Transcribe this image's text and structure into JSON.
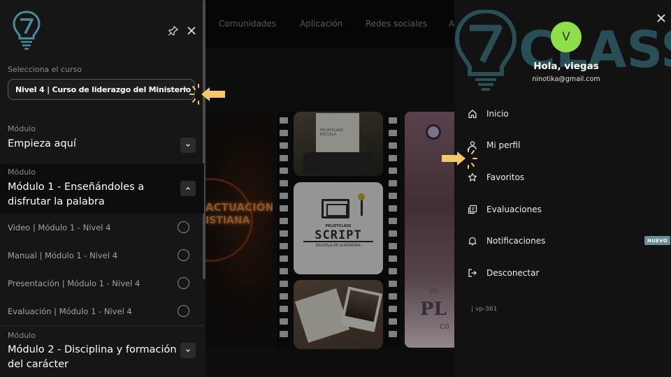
{
  "topnav": {
    "items": [
      "Comunidades",
      "Aplicación",
      "Redes sociales",
      "A"
    ]
  },
  "background": {
    "left_card_text": [
      "ACTUACIÓN",
      "ISTIANA"
    ],
    "script_card": {
      "small_top": "PELIZYCLASS",
      "title": "SCRIPT",
      "subtitle": "ESCUELA DE GUIONISTAS",
      "paper_text": "PELIZYCLASS ESCUELA"
    },
    "right_card_text": {
      "big": "PL",
      "small": "co",
      "script": "m"
    }
  },
  "left_drawer": {
    "course_label": "Selecciona el curso",
    "course_value": "Nivel 4 | Curso de liderazgo del Ministerio",
    "modules": [
      {
        "tag": "Módulo",
        "title": "Empieza aquí",
        "expanded": false
      },
      {
        "tag": "Módulo",
        "title": "Módulo 1 - Enseñándoles a disfrutar la palabra",
        "expanded": true,
        "lessons": [
          "Video | Módulo 1 - Nivel 4",
          "Manual | Módulo 1 - Nivel 4",
          "Presentación | Módulo 1 - Nivel 4",
          "Evaluación | Módulo 1 - Nivel 4"
        ]
      },
      {
        "tag": "Módulo",
        "title": "Módulo 2 - Disciplina y formación del carácter",
        "expanded": false
      }
    ]
  },
  "right_drawer": {
    "logo_text": "CLASS",
    "avatar_letter": "V",
    "greeting": "Hola, viegas",
    "email": "ninotika@gmail.com",
    "menu": [
      {
        "icon": "home-icon",
        "label": "Inicio"
      },
      {
        "icon": "user-icon",
        "label": "Mi perfil"
      },
      {
        "icon": "star-icon",
        "label": "Favoritos"
      },
      {
        "icon": "evaluations-icon",
        "label": "Evaluaciones"
      },
      {
        "icon": "bell-icon",
        "label": "Notificaciones"
      },
      {
        "icon": "logout-icon",
        "label": "Desconectar"
      }
    ],
    "notifications_badge": "NUEVO",
    "version": "| vp-361"
  },
  "colors": {
    "accent_green": "#8ee04a",
    "logo_teal": "#3f7f8c",
    "badge": "#6a8e96",
    "hint_yellow": "#f5c86a"
  }
}
